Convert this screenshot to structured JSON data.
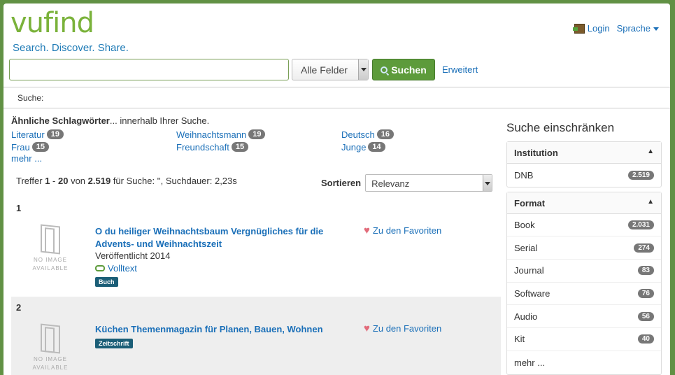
{
  "header": {
    "logo_text": "vufind",
    "tagline": "Search. Discover. Share.",
    "login_label": "Login",
    "language_label": "Sprache"
  },
  "search": {
    "value": "",
    "type_selected": "Alle Felder",
    "submit_label": "Suchen",
    "advanced_label": "Erweitert"
  },
  "breadcrumb": {
    "label": "Suche:"
  },
  "related": {
    "heading_bold": "Ähnliche Schlagwörter",
    "heading_rest": "... innerhalb Ihrer Suche.",
    "tags": [
      {
        "label": "Literatur",
        "count": "19"
      },
      {
        "label": "Weihnachtsmann",
        "count": "19"
      },
      {
        "label": "Deutsch",
        "count": "16"
      },
      {
        "label": "Frau",
        "count": "15"
      },
      {
        "label": "Freundschaft",
        "count": "15"
      },
      {
        "label": "Junge",
        "count": "14"
      }
    ],
    "more_label": "mehr ..."
  },
  "results_info": {
    "prefix": "Treffer ",
    "start": "1",
    "sep": " - ",
    "end": "20",
    "of": " von ",
    "total": "2.519",
    "suffix": " für Suche: '', Suchdauer: 2,23s"
  },
  "sort": {
    "label": "Sortieren",
    "selected": "Relevanz"
  },
  "results": [
    {
      "number": "1",
      "no_image": "NO IMAGE AVAILABLE",
      "title": "O du heiliger Weihnachtsbaum Vergnügliches für die Advents- und Weihnachtszeit",
      "published": "Veröffentlicht 2014",
      "fulltext": "Volltext",
      "format": "Buch",
      "favorite": "Zu den Favoriten"
    },
    {
      "number": "2",
      "no_image": "NO IMAGE AVAILABLE",
      "title": "Küchen Themenmagazin für Planen, Bauen, Wohnen",
      "format": "Zeitschrift",
      "favorite": "Zu den Favoriten"
    }
  ],
  "sidebar": {
    "heading": "Suche einschränken",
    "facets": [
      {
        "title": "Institution",
        "items": [
          {
            "label": "DNB",
            "count": "2.519"
          }
        ]
      },
      {
        "title": "Format",
        "items": [
          {
            "label": "Book",
            "count": "2.031"
          },
          {
            "label": "Serial",
            "count": "274"
          },
          {
            "label": "Journal",
            "count": "83"
          },
          {
            "label": "Software",
            "count": "76"
          },
          {
            "label": "Audio",
            "count": "56"
          },
          {
            "label": "Kit",
            "count": "40"
          }
        ],
        "more_label": "mehr ..."
      }
    ]
  },
  "colors": {
    "frame": "#619144",
    "link": "#1a6fb8",
    "accent": "#5d9b3b",
    "badge": "#1b5e77"
  }
}
